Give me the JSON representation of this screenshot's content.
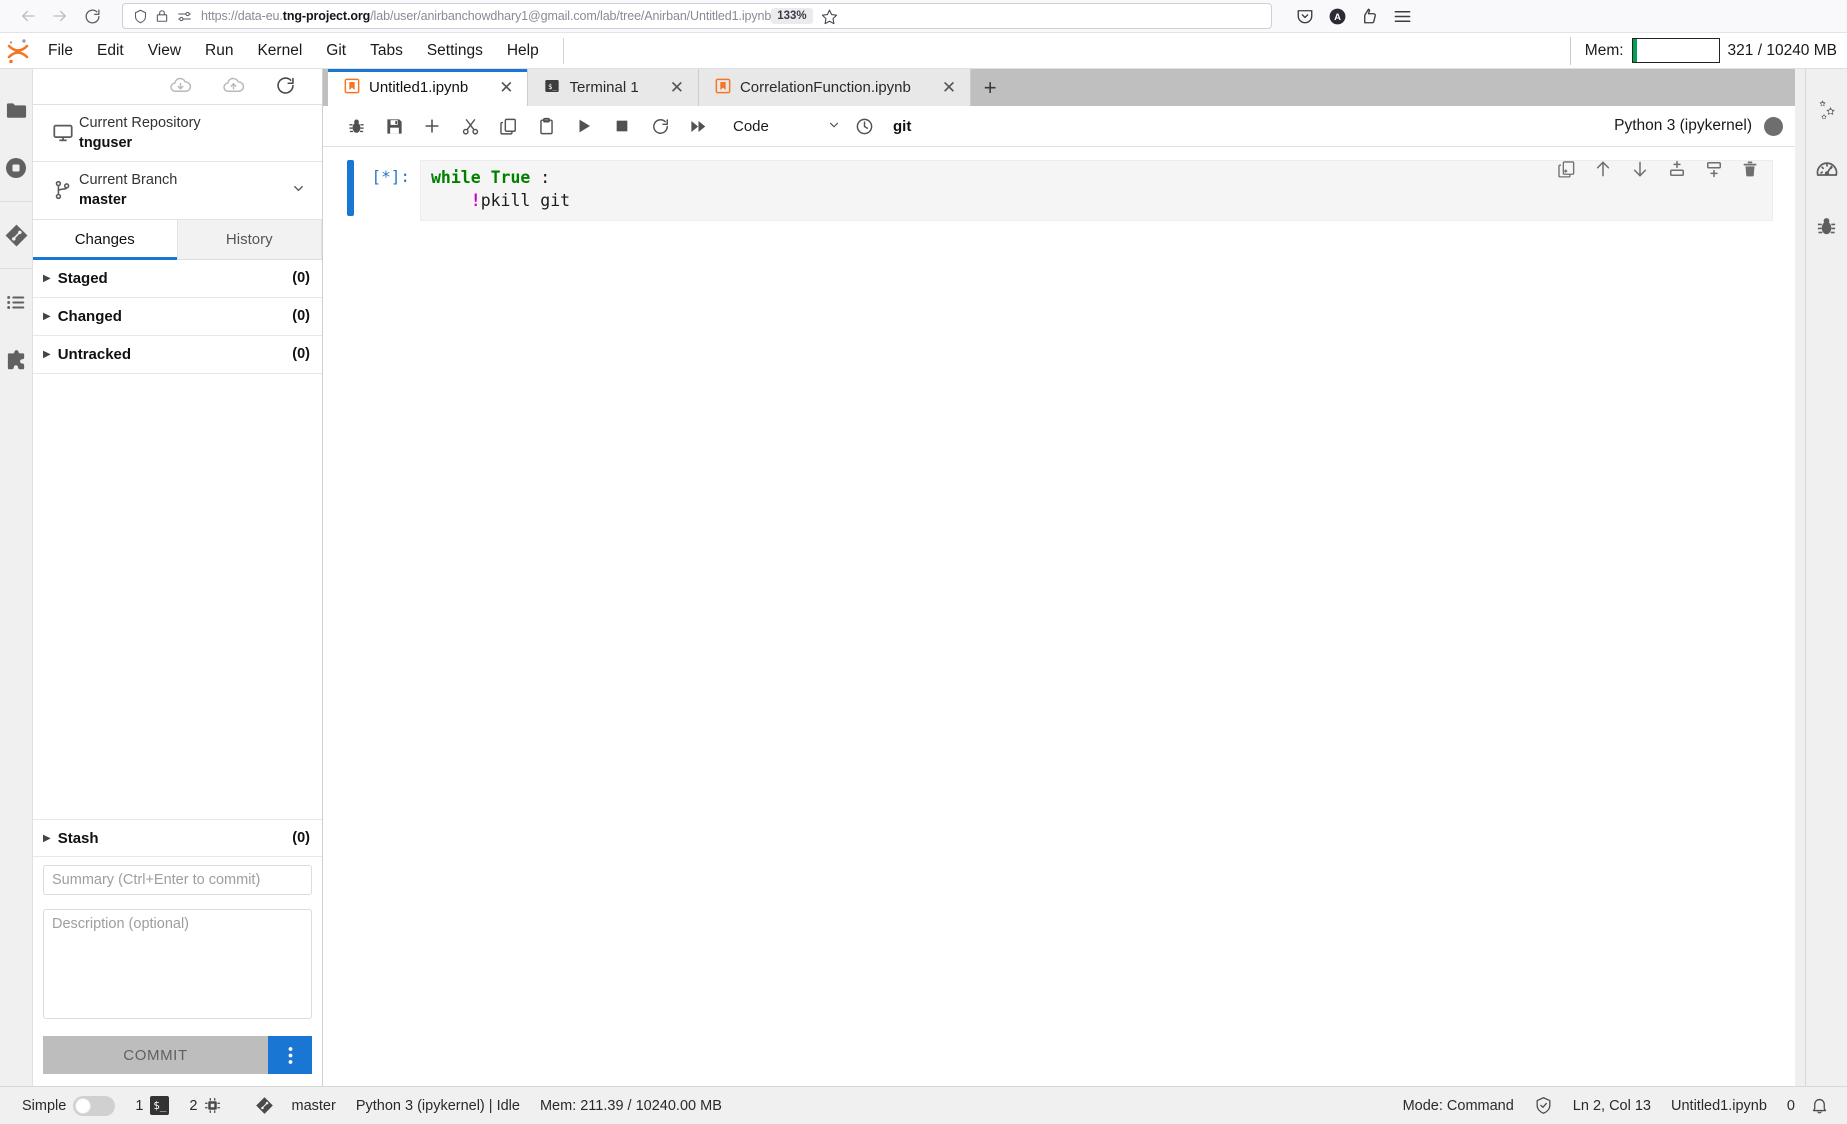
{
  "browser": {
    "back_icon": "arrow-left-icon",
    "forward_icon": "arrow-right-icon",
    "reload_icon": "reload-icon",
    "shield_icon": "shield-icon",
    "lock_icon": "lock-icon",
    "permissions_icon": "permissions-icon",
    "url_prefix": "https://data-eu.",
    "url_domain": "tng-project.org",
    "url_suffix": "/lab/user/anirbanchowdhary1@gmail.com/lab/tree/Anirban/Untitled1.ipynb",
    "zoom_level": "133%",
    "bookmark_icon": "star-icon",
    "pocket_icon": "pocket-icon",
    "account_icon": "account-avatar-icon",
    "extensions_icon": "extensions-icon",
    "menu_icon": "hamburger-menu-icon"
  },
  "menubar": {
    "logo_icon": "jupyter-logo-icon",
    "items": [
      {
        "label": "File"
      },
      {
        "label": "Edit"
      },
      {
        "label": "View"
      },
      {
        "label": "Run"
      },
      {
        "label": "Kernel"
      },
      {
        "label": "Git"
      },
      {
        "label": "Tabs"
      },
      {
        "label": "Settings"
      },
      {
        "label": "Help"
      }
    ],
    "memory": {
      "label": "Mem:",
      "value": "321 / 10240 MB",
      "fill_color": "#00a152"
    }
  },
  "activity_bar": {
    "items": [
      {
        "name": "file-browser",
        "icon": "folder-icon"
      },
      {
        "name": "running-terminals-kernels",
        "icon": "stop-circle-icon"
      },
      {
        "name": "git-panel",
        "icon": "git-icon"
      },
      {
        "name": "table-of-contents",
        "icon": "list-icon"
      },
      {
        "name": "extension-manager",
        "icon": "puzzle-piece-icon"
      }
    ]
  },
  "right_bar": {
    "items": [
      {
        "name": "property-inspector",
        "icon": "gears-icon"
      },
      {
        "name": "dashboard",
        "icon": "gauge-icon"
      },
      {
        "name": "debugger",
        "icon": "bug-icon"
      }
    ]
  },
  "git_panel": {
    "toolbar": {
      "pull_icon": "cloud-download-icon",
      "push_icon": "cloud-upload-icon",
      "refresh_icon": "refresh-icon"
    },
    "repository": {
      "icon": "desktop-icon",
      "caption": "Current Repository",
      "value": "tnguser"
    },
    "branch": {
      "icon": "branch-icon",
      "caption": "Current Branch",
      "value": "master",
      "caret_icon": "chevron-down-icon"
    },
    "tabs": [
      {
        "label": "Changes",
        "active": true
      },
      {
        "label": "History",
        "active": false
      }
    ],
    "sections": [
      {
        "label": "Staged",
        "count": "(0)"
      },
      {
        "label": "Changed",
        "count": "(0)"
      },
      {
        "label": "Untracked",
        "count": "(0)"
      }
    ],
    "stash": {
      "label": "Stash",
      "count": "(0)"
    },
    "commit": {
      "summary_value": "",
      "summary_placeholder": "Summary (Ctrl+Enter to commit)",
      "description_value": "",
      "description_placeholder": "Description (optional)",
      "button_label": "COMMIT",
      "menu_icon": "vertical-dots-icon"
    }
  },
  "tabbar": {
    "tabs": [
      {
        "label": "Untitled1.ipynb",
        "icon": "notebook-icon",
        "active": true,
        "close_icon": "close-icon"
      },
      {
        "label": "Terminal 1",
        "icon": "terminal-icon",
        "active": false,
        "close_icon": "close-icon"
      },
      {
        "label": "CorrelationFunction.ipynb",
        "icon": "notebook-icon",
        "active": false,
        "close_icon": "close-icon"
      }
    ],
    "add_icon": "plus-icon"
  },
  "notebook_toolbar": {
    "buttons": [
      {
        "name": "debugger-toggle",
        "icon": "bug-icon"
      },
      {
        "name": "save-notebook",
        "icon": "save-icon"
      },
      {
        "name": "insert-cell",
        "icon": "plus-icon"
      },
      {
        "name": "cut-cell",
        "icon": "scissors-icon"
      },
      {
        "name": "copy-cell",
        "icon": "copy-icon"
      },
      {
        "name": "paste-cell",
        "icon": "paste-icon"
      },
      {
        "name": "run-cell",
        "icon": "play-icon"
      },
      {
        "name": "interrupt-kernel",
        "icon": "stop-icon"
      },
      {
        "name": "restart-kernel",
        "icon": "restart-icon"
      },
      {
        "name": "restart-run-all",
        "icon": "fast-forward-icon"
      }
    ],
    "cell_type": "Code",
    "cell_type_caret": "chevron-down-icon",
    "history_icon": "clock-icon",
    "git_label": "git",
    "kernel_name": "Python 3 (ipykernel)",
    "kernel_status_icon": "kernel-busy-dot"
  },
  "notebook": {
    "cells": [
      {
        "prompt": "[*]:",
        "lines": [
          {
            "segments": [
              {
                "text": "while",
                "style": "kw"
              },
              {
                "text": " ",
                "style": "plain"
              },
              {
                "text": "True",
                "style": "kw"
              },
              {
                "text": " :",
                "style": "plain"
              }
            ]
          },
          {
            "segments": [
              {
                "text": "    ",
                "style": "plain"
              },
              {
                "text": "!",
                "style": "bang"
              },
              {
                "text": "pkill git",
                "style": "plain"
              }
            ]
          }
        ]
      }
    ],
    "cell_tools": [
      {
        "name": "duplicate-cell",
        "icon": "duplicate-icon"
      },
      {
        "name": "move-cell-up",
        "icon": "arrow-up-icon"
      },
      {
        "name": "move-cell-down",
        "icon": "arrow-down-icon"
      },
      {
        "name": "insert-cell-above",
        "icon": "insert-above-icon"
      },
      {
        "name": "insert-cell-below",
        "icon": "insert-below-icon"
      },
      {
        "name": "delete-cell",
        "icon": "trash-icon"
      }
    ]
  },
  "statusbar": {
    "simple_label": "Simple",
    "simple_toggle_on": false,
    "terminal_count": "1",
    "terminal_icon": "terminal-icon",
    "kernel_count": "2",
    "kernel_icon": "cpu-icon",
    "git_icon": "git-icon",
    "branch": "master",
    "kernel_status": "Python 3 (ipykernel) | Idle",
    "memory": "Mem: 211.39 / 10240.00 MB",
    "mode": "Mode: Command",
    "trust_icon": "shield-check-icon",
    "cursor_position": "Ln 2, Col 13",
    "filename": "Untitled1.ipynb",
    "notification_count": "0",
    "bell_icon": "bell-icon"
  }
}
